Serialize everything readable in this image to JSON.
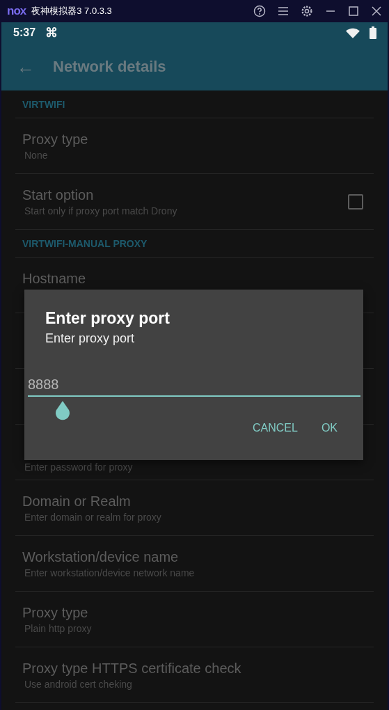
{
  "window": {
    "logo": "nox",
    "title": "夜神模拟器3 7.0.3.3"
  },
  "status_bar": {
    "time": "5:37",
    "notification": "⌘"
  },
  "app_bar": {
    "back": "←",
    "title": "Network details"
  },
  "list": [
    {
      "kind": "header",
      "title": "VIRTWIFI"
    },
    {
      "kind": "row",
      "title": "Proxy type",
      "subtitle": "None"
    },
    {
      "kind": "check",
      "title": "Start option",
      "subtitle": "Start only if proxy port match Drony",
      "checked": false
    },
    {
      "kind": "header",
      "title": "VIRTWIFI-MANUAL PROXY"
    },
    {
      "kind": "row",
      "title": "Hostname"
    },
    {
      "kind": "row"
    },
    {
      "kind": "row"
    },
    {
      "kind": "row",
      "subtitle": "Enter password for proxy"
    },
    {
      "kind": "row",
      "title": "Domain or Realm",
      "subtitle": "Enter domain or realm for proxy"
    },
    {
      "kind": "row",
      "title": "Workstation/device name",
      "subtitle": "Enter workstation/device network name"
    },
    {
      "kind": "row",
      "title": "Proxy type",
      "subtitle": "Plain http proxy"
    },
    {
      "kind": "row",
      "title": "Proxy type HTTPS certificate check",
      "subtitle": "Use android cert cheking"
    }
  ],
  "dialog": {
    "title": "Enter proxy port",
    "message": "Enter proxy port",
    "value": "8888",
    "buttons": [
      "CANCEL",
      "OK"
    ]
  }
}
